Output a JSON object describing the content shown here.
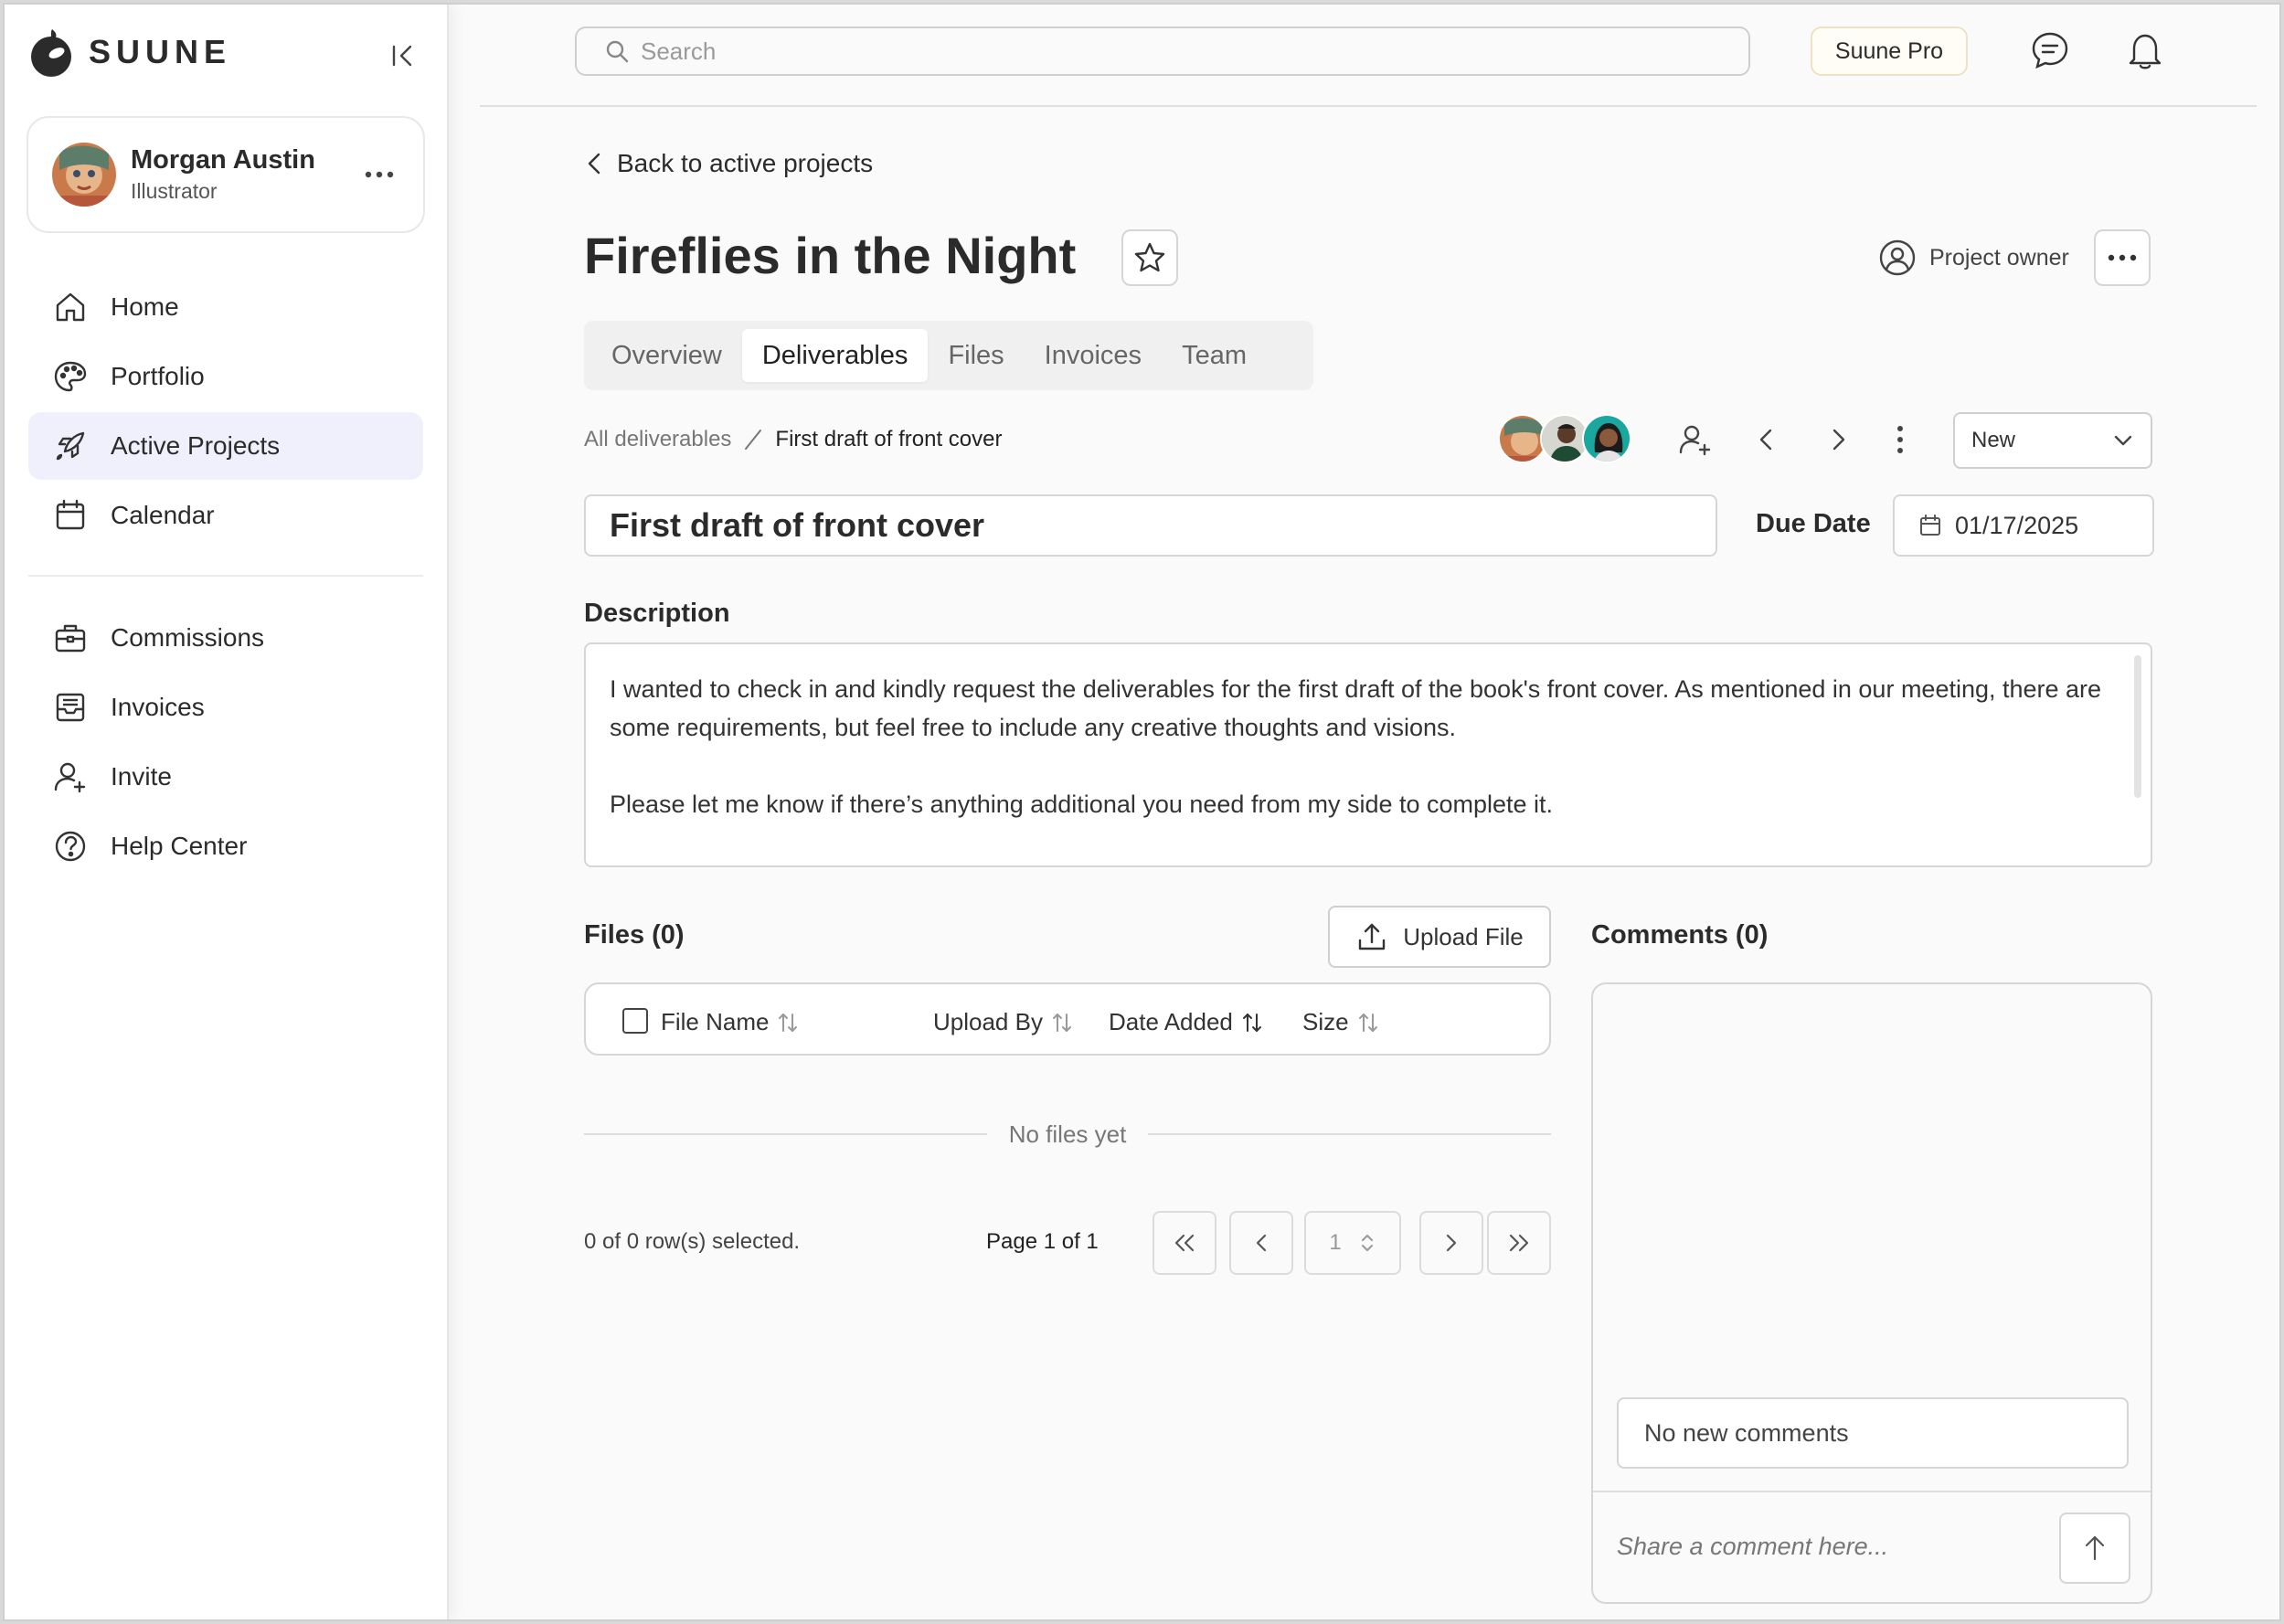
{
  "brand": {
    "name": "SUUNE"
  },
  "profile": {
    "name": "Morgan Austin",
    "role": "Illustrator"
  },
  "nav": {
    "primary": [
      {
        "label": "Home",
        "icon": "home-icon",
        "active": false
      },
      {
        "label": "Portfolio",
        "icon": "palette-icon",
        "active": false
      },
      {
        "label": "Active Projects",
        "icon": "rocket-icon",
        "active": true
      },
      {
        "label": "Calendar",
        "icon": "calendar-icon",
        "active": false
      }
    ],
    "secondary": [
      {
        "label": "Commissions",
        "icon": "briefcase-icon"
      },
      {
        "label": "Invoices",
        "icon": "inbox-icon"
      },
      {
        "label": "Invite",
        "icon": "user-plus-icon"
      },
      {
        "label": "Help Center",
        "icon": "help-circle-icon"
      }
    ]
  },
  "topbar": {
    "search_placeholder": "Search",
    "pro_label": "Suune Pro"
  },
  "project": {
    "back_label": "Back to active projects",
    "title": "Fireflies in the Night",
    "owner_label": "Project owner",
    "tabs": [
      "Overview",
      "Deliverables",
      "Files",
      "Invoices",
      "Team"
    ],
    "active_tab": "Deliverables"
  },
  "deliverable": {
    "breadcrumb_root": "All deliverables",
    "breadcrumb_current": "First draft of front cover",
    "status": "New",
    "title": "First draft of front cover",
    "due_label": "Due Date",
    "due_date": "01/17/2025",
    "description_label": "Description",
    "description": [
      "I wanted to check in and kindly request the deliverables for the first draft of the book's front cover. As mentioned in our meeting, there are some requirements, but feel free to include any creative thoughts and visions.",
      "Please let me know if there’s anything additional you need from my side to complete it."
    ]
  },
  "files": {
    "title": "Files (0)",
    "upload_label": "Upload File",
    "columns": [
      "File Name",
      "Upload By",
      "Date Added",
      "Size"
    ],
    "empty_text": "No files yet",
    "rows_selected": "0 of 0 row(s) selected.",
    "page_info": "Page 1 of 1",
    "page_value": "1"
  },
  "comments": {
    "title": "Comments (0)",
    "empty_text": "No new comments",
    "input_placeholder": "Share a comment here..."
  },
  "colors": {
    "active_nav_bg": "#eff0fb",
    "pro_border": "#ece3c6",
    "text": "#2b2b2b"
  }
}
